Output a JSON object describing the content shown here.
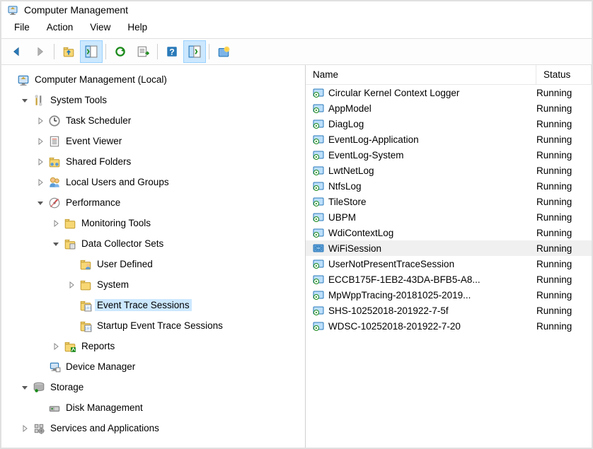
{
  "title": "Computer Management",
  "menu": [
    "File",
    "Action",
    "View",
    "Help"
  ],
  "toolbar": [
    {
      "name": "back-icon",
      "active": false
    },
    {
      "name": "forward-icon",
      "active": false
    },
    {
      "name": "sep"
    },
    {
      "name": "up-folder-icon",
      "active": false
    },
    {
      "name": "show-hide-tree-icon",
      "active": true
    },
    {
      "name": "sep"
    },
    {
      "name": "refresh-icon",
      "active": false
    },
    {
      "name": "export-list-icon",
      "active": false
    },
    {
      "name": "sep"
    },
    {
      "name": "help-icon",
      "active": false
    },
    {
      "name": "show-hide-action-icon",
      "active": true
    },
    {
      "name": "sep"
    },
    {
      "name": "new-session-icon",
      "active": false
    }
  ],
  "tree": {
    "root": {
      "label": "Computer Management (Local)",
      "icon": "compmgmt-icon",
      "indent": 0,
      "caret": "open",
      "children": [
        {
          "label": "System Tools",
          "icon": "systools-icon",
          "indent": 1,
          "caret": "open",
          "children": [
            {
              "label": "Task Scheduler",
              "icon": "clock-icon",
              "indent": 2,
              "caret": "closed"
            },
            {
              "label": "Event Viewer",
              "icon": "eventviewer-icon",
              "indent": 2,
              "caret": "closed"
            },
            {
              "label": "Shared Folders",
              "icon": "sharedfolders-icon",
              "indent": 2,
              "caret": "closed"
            },
            {
              "label": "Local Users and Groups",
              "icon": "users-icon",
              "indent": 2,
              "caret": "closed"
            },
            {
              "label": "Performance",
              "icon": "perf-icon",
              "indent": 2,
              "caret": "open",
              "children": [
                {
                  "label": "Monitoring Tools",
                  "icon": "folder-icon",
                  "indent": 3,
                  "caret": "closed"
                },
                {
                  "label": "Data Collector Sets",
                  "icon": "dcs-icon",
                  "indent": 3,
                  "caret": "open",
                  "children": [
                    {
                      "label": "User Defined",
                      "icon": "folder-user-icon",
                      "indent": 4,
                      "caret": "none"
                    },
                    {
                      "label": "System",
                      "icon": "folder-icon",
                      "indent": 4,
                      "caret": "closed"
                    },
                    {
                      "label": "Event Trace Sessions",
                      "icon": "ets-icon",
                      "indent": 4,
                      "caret": "none",
                      "selected": true
                    },
                    {
                      "label": "Startup Event Trace Sessions",
                      "icon": "ets-icon",
                      "indent": 4,
                      "caret": "none"
                    }
                  ]
                },
                {
                  "label": "Reports",
                  "icon": "folder-report-icon",
                  "indent": 3,
                  "caret": "closed"
                }
              ]
            },
            {
              "label": "Device Manager",
              "icon": "devmgr-icon",
              "indent": 2,
              "caret": "none"
            }
          ]
        },
        {
          "label": "Storage",
          "icon": "storage-icon",
          "indent": 1,
          "caret": "open",
          "children": [
            {
              "label": "Disk Management",
              "icon": "diskmgmt-icon",
              "indent": 2,
              "caret": "none"
            }
          ]
        },
        {
          "label": "Services and Applications",
          "icon": "services-icon",
          "indent": 1,
          "caret": "closed"
        }
      ]
    }
  },
  "list": {
    "columns": {
      "name": "Name",
      "status": "Status"
    },
    "rows": [
      {
        "name": "Circular Kernel Context Logger",
        "status": "Running",
        "selected": false
      },
      {
        "name": "AppModel",
        "status": "Running",
        "selected": false
      },
      {
        "name": "DiagLog",
        "status": "Running",
        "selected": false
      },
      {
        "name": "EventLog-Application",
        "status": "Running",
        "selected": false
      },
      {
        "name": "EventLog-System",
        "status": "Running",
        "selected": false
      },
      {
        "name": "LwtNetLog",
        "status": "Running",
        "selected": false
      },
      {
        "name": "NtfsLog",
        "status": "Running",
        "selected": false
      },
      {
        "name": "TileStore",
        "status": "Running",
        "selected": false
      },
      {
        "name": "UBPM",
        "status": "Running",
        "selected": false
      },
      {
        "name": "WdiContextLog",
        "status": "Running",
        "selected": false
      },
      {
        "name": "WiFiSession",
        "status": "Running",
        "selected": true
      },
      {
        "name": "UserNotPresentTraceSession",
        "status": "Running",
        "selected": false
      },
      {
        "name": "ECCB175F-1EB2-43DA-BFB5-A8...",
        "status": "Running",
        "selected": false
      },
      {
        "name": "MpWppTracing-20181025-2019...",
        "status": "Running",
        "selected": false
      },
      {
        "name": "SHS-10252018-201922-7-5f",
        "status": "Running",
        "selected": false
      },
      {
        "name": "WDSC-10252018-201922-7-20",
        "status": "Running",
        "selected": false
      }
    ]
  }
}
